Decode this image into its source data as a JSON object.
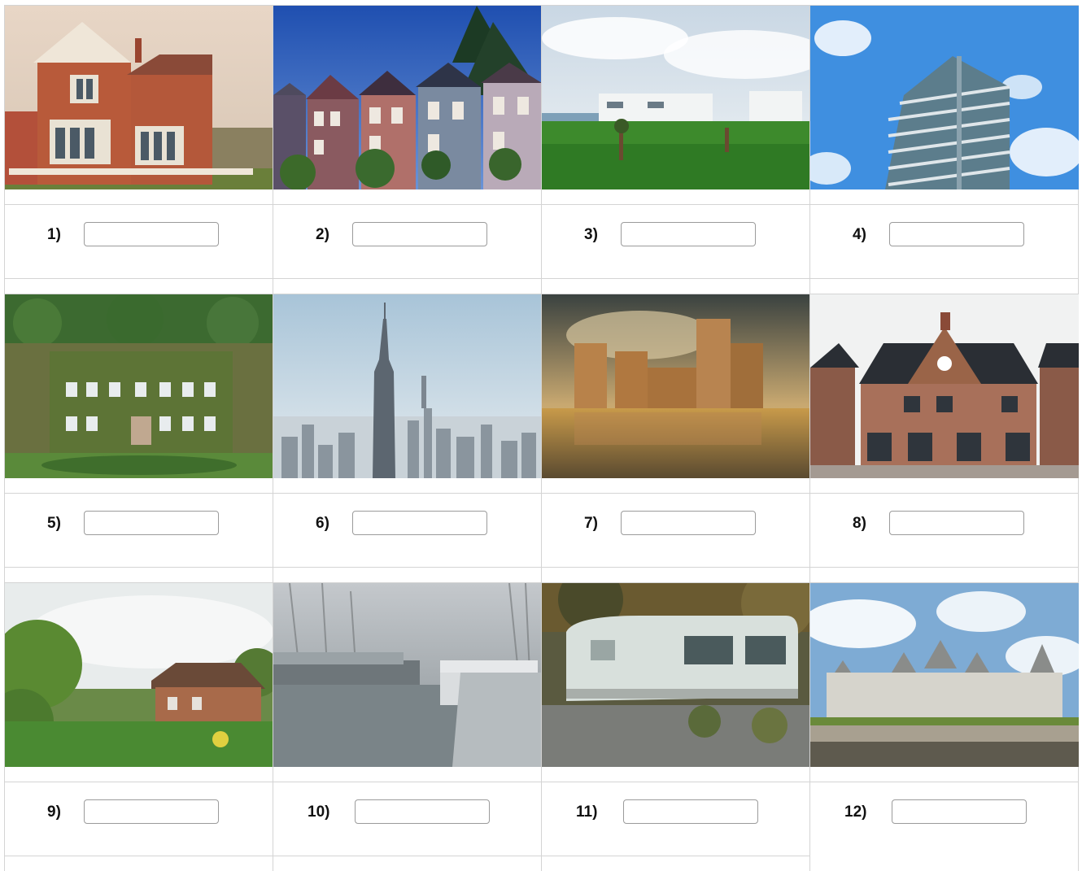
{
  "items": [
    {
      "label": "1)",
      "value": ""
    },
    {
      "label": "2)",
      "value": ""
    },
    {
      "label": "3)",
      "value": ""
    },
    {
      "label": "4)",
      "value": ""
    },
    {
      "label": "5)",
      "value": ""
    },
    {
      "label": "6)",
      "value": ""
    },
    {
      "label": "7)",
      "value": ""
    },
    {
      "label": "8)",
      "value": ""
    },
    {
      "label": "9)",
      "value": ""
    },
    {
      "label": "10)",
      "value": ""
    },
    {
      "label": "11)",
      "value": ""
    },
    {
      "label": "12)",
      "value": ""
    }
  ],
  "images": [
    {
      "icon": "victorian-house-photo"
    },
    {
      "icon": "painted-ladies-photo"
    },
    {
      "icon": "mobile-home-park-photo"
    },
    {
      "icon": "apartment-tower-photo"
    },
    {
      "icon": "ivy-mansion-photo"
    },
    {
      "icon": "skyscraper-city-photo"
    },
    {
      "icon": "castle-moat-photo"
    },
    {
      "icon": "brick-semi-detached-photo"
    },
    {
      "icon": "country-cottage-photo"
    },
    {
      "icon": "houseboat-canal-photo"
    },
    {
      "icon": "caravan-photo"
    },
    {
      "icon": "chateau-photo"
    }
  ]
}
